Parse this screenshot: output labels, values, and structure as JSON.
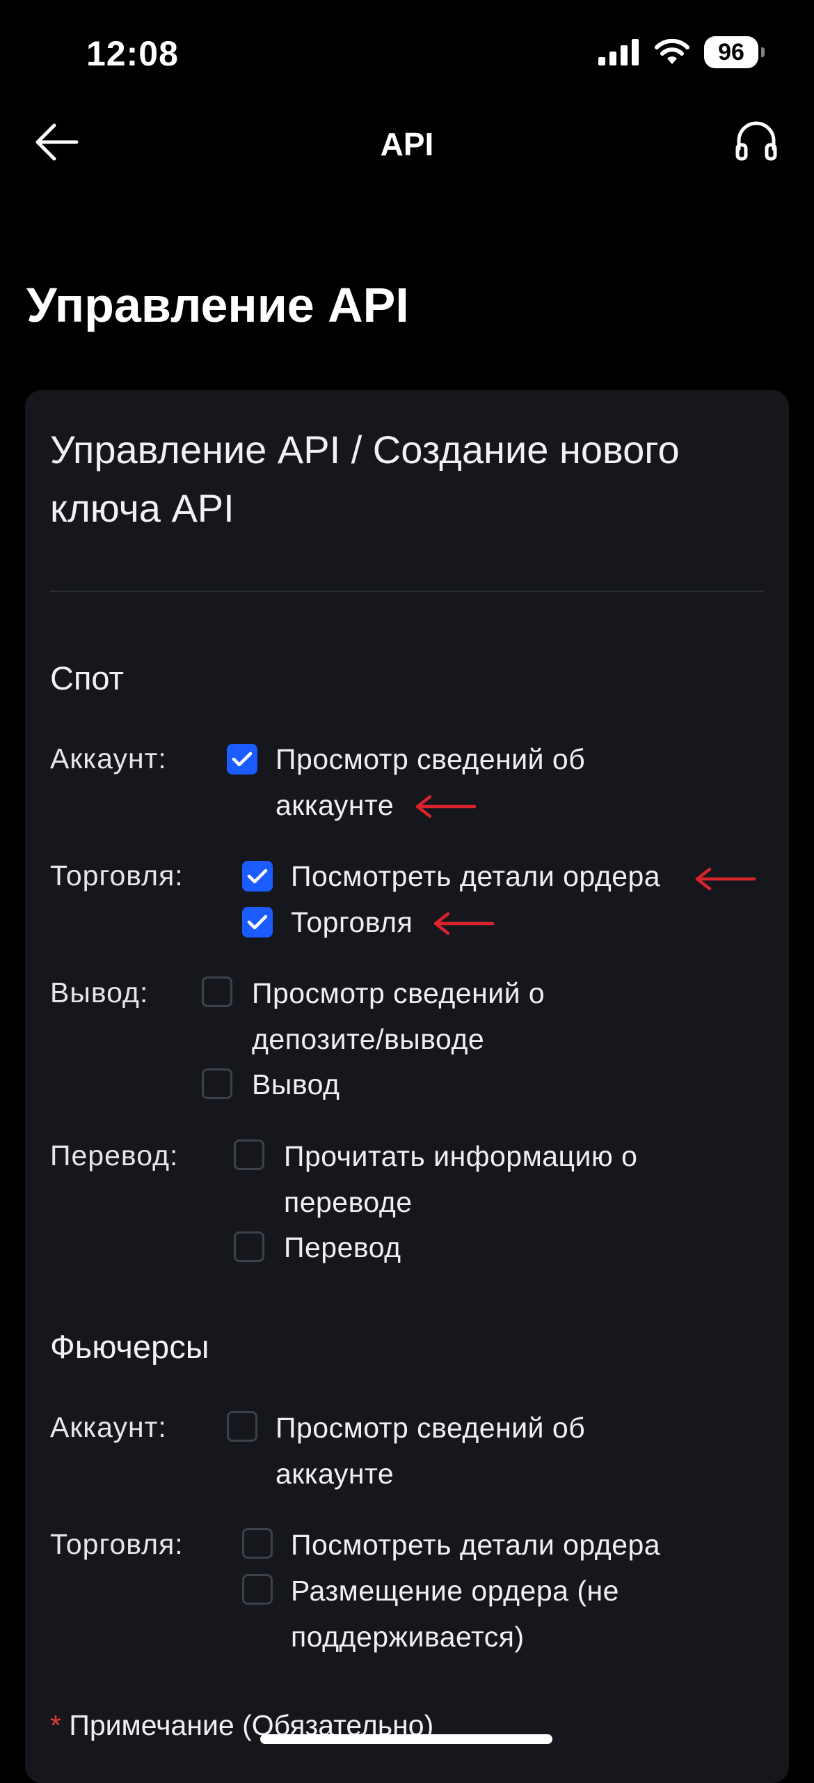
{
  "status_bar": {
    "time": "12:08",
    "battery": "96"
  },
  "nav": {
    "title": "API",
    "back_icon": "back-arrow-icon",
    "support_icon": "headset-icon"
  },
  "page_title": "Управление API",
  "card": {
    "title": "Управление API / Создание нового ключа API",
    "spot": {
      "heading": "Спот",
      "account_label": "Аккаунт:",
      "account_opt1": "Просмотр сведений об аккаунте",
      "account_opt1_checked": true,
      "trade_label": "Торговля:",
      "trade_opt1": "Посмотреть детали ордера",
      "trade_opt1_checked": true,
      "trade_opt2": "Торговля",
      "trade_opt2_checked": true,
      "withdraw_label": "Вывод:",
      "withdraw_opt1": "Просмотр сведений о депозите/выводе",
      "withdraw_opt1_checked": false,
      "withdraw_opt2": "Вывод",
      "withdraw_opt2_checked": false,
      "transfer_label": "Перевод:",
      "transfer_opt1": "Прочитать информацию о переводе",
      "transfer_opt1_checked": false,
      "transfer_opt2": "Перевод",
      "transfer_opt2_checked": false
    },
    "futures": {
      "heading": "Фьючерсы",
      "account_label": "Аккаунт:",
      "account_opt1": "Просмотр сведений об аккаунте",
      "account_opt1_checked": false,
      "trade_label": "Торговля:",
      "trade_opt1": "Посмотреть детали ордера",
      "trade_opt1_checked": false,
      "trade_opt2": "Размещение ордера (не поддерживается)",
      "trade_opt2_checked": false
    },
    "note_star": "*",
    "note_label": "Примечание (Обязательно)"
  },
  "colors": {
    "accent": "#1a5cff",
    "annotation_arrow": "#d9232d",
    "card_bg": "#16171d"
  }
}
